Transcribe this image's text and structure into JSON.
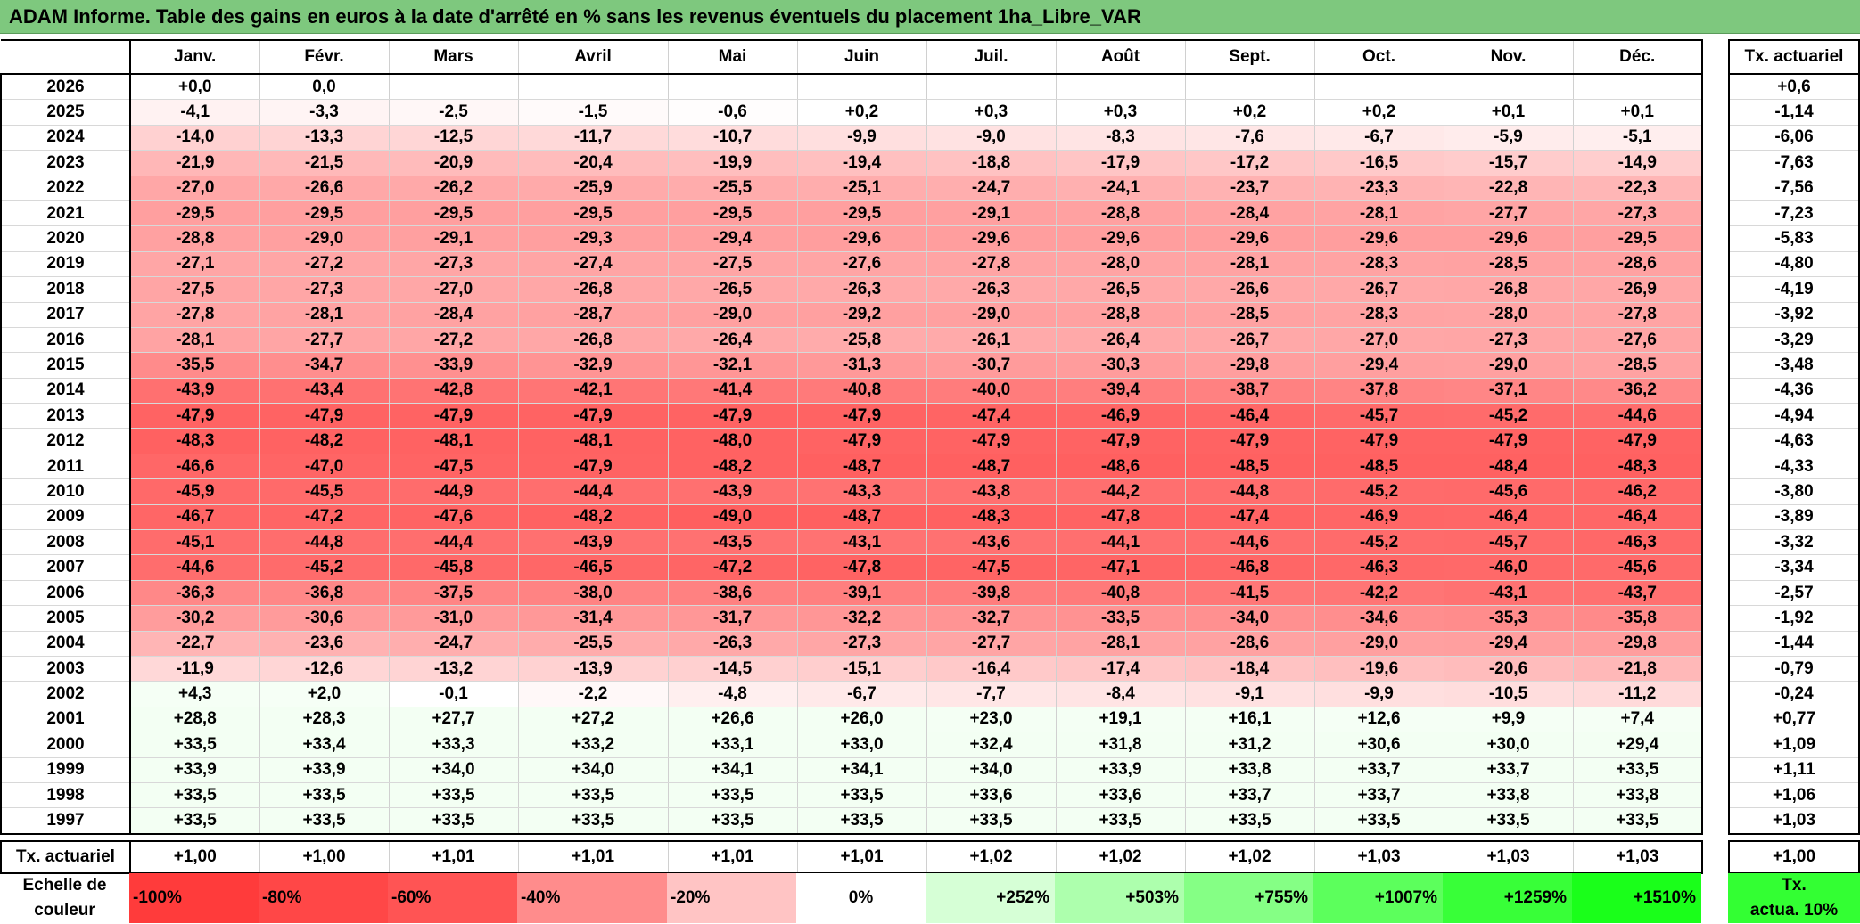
{
  "title": "ADAM Informe. Table des gains en euros à la date d'arrêté en % sans les revenus éventuels du placement 1ha_Libre_VAR",
  "months": [
    "Janv.",
    "Févr.",
    "Mars",
    "Avril",
    "Mai",
    "Juin",
    "Juil.",
    "Août",
    "Sept.",
    "Oct.",
    "Nov.",
    "Déc."
  ],
  "side_header": "Tx. actuariel",
  "rows": [
    {
      "year": "2026",
      "values": [
        "+0,0",
        "0,0",
        "",
        "",
        "",
        "",
        "",
        "",
        "",
        "",
        "",
        ""
      ],
      "act": "+0,6"
    },
    {
      "year": "2025",
      "values": [
        "-4,1",
        "-3,3",
        "-2,5",
        "-1,5",
        "-0,6",
        "+0,2",
        "+0,3",
        "+0,3",
        "+0,2",
        "+0,2",
        "+0,1",
        "+0,1"
      ],
      "act": "-1,14"
    },
    {
      "year": "2024",
      "values": [
        "-14,0",
        "-13,3",
        "-12,5",
        "-11,7",
        "-10,7",
        "-9,9",
        "-9,0",
        "-8,3",
        "-7,6",
        "-6,7",
        "-5,9",
        "-5,1"
      ],
      "act": "-6,06"
    },
    {
      "year": "2023",
      "values": [
        "-21,9",
        "-21,5",
        "-20,9",
        "-20,4",
        "-19,9",
        "-19,4",
        "-18,8",
        "-17,9",
        "-17,2",
        "-16,5",
        "-15,7",
        "-14,9"
      ],
      "act": "-7,63"
    },
    {
      "year": "2022",
      "values": [
        "-27,0",
        "-26,6",
        "-26,2",
        "-25,9",
        "-25,5",
        "-25,1",
        "-24,7",
        "-24,1",
        "-23,7",
        "-23,3",
        "-22,8",
        "-22,3"
      ],
      "act": "-7,56"
    },
    {
      "year": "2021",
      "values": [
        "-29,5",
        "-29,5",
        "-29,5",
        "-29,5",
        "-29,5",
        "-29,5",
        "-29,1",
        "-28,8",
        "-28,4",
        "-28,1",
        "-27,7",
        "-27,3"
      ],
      "act": "-7,23"
    },
    {
      "year": "2020",
      "values": [
        "-28,8",
        "-29,0",
        "-29,1",
        "-29,3",
        "-29,4",
        "-29,6",
        "-29,6",
        "-29,6",
        "-29,6",
        "-29,6",
        "-29,6",
        "-29,5"
      ],
      "act": "-5,83"
    },
    {
      "year": "2019",
      "values": [
        "-27,1",
        "-27,2",
        "-27,3",
        "-27,4",
        "-27,5",
        "-27,6",
        "-27,8",
        "-28,0",
        "-28,1",
        "-28,3",
        "-28,5",
        "-28,6"
      ],
      "act": "-4,80"
    },
    {
      "year": "2018",
      "values": [
        "-27,5",
        "-27,3",
        "-27,0",
        "-26,8",
        "-26,5",
        "-26,3",
        "-26,3",
        "-26,5",
        "-26,6",
        "-26,7",
        "-26,8",
        "-26,9"
      ],
      "act": "-4,19"
    },
    {
      "year": "2017",
      "values": [
        "-27,8",
        "-28,1",
        "-28,4",
        "-28,7",
        "-29,0",
        "-29,2",
        "-29,0",
        "-28,8",
        "-28,5",
        "-28,3",
        "-28,0",
        "-27,8"
      ],
      "act": "-3,92"
    },
    {
      "year": "2016",
      "values": [
        "-28,1",
        "-27,7",
        "-27,2",
        "-26,8",
        "-26,4",
        "-25,8",
        "-26,1",
        "-26,4",
        "-26,7",
        "-27,0",
        "-27,3",
        "-27,6"
      ],
      "act": "-3,29"
    },
    {
      "year": "2015",
      "values": [
        "-35,5",
        "-34,7",
        "-33,9",
        "-32,9",
        "-32,1",
        "-31,3",
        "-30,7",
        "-30,3",
        "-29,8",
        "-29,4",
        "-29,0",
        "-28,5"
      ],
      "act": "-3,48"
    },
    {
      "year": "2014",
      "values": [
        "-43,9",
        "-43,4",
        "-42,8",
        "-42,1",
        "-41,4",
        "-40,8",
        "-40,0",
        "-39,4",
        "-38,7",
        "-37,8",
        "-37,1",
        "-36,2"
      ],
      "act": "-4,36"
    },
    {
      "year": "2013",
      "values": [
        "-47,9",
        "-47,9",
        "-47,9",
        "-47,9",
        "-47,9",
        "-47,9",
        "-47,4",
        "-46,9",
        "-46,4",
        "-45,7",
        "-45,2",
        "-44,6"
      ],
      "act": "-4,94"
    },
    {
      "year": "2012",
      "values": [
        "-48,3",
        "-48,2",
        "-48,1",
        "-48,1",
        "-48,0",
        "-47,9",
        "-47,9",
        "-47,9",
        "-47,9",
        "-47,9",
        "-47,9",
        "-47,9"
      ],
      "act": "-4,63"
    },
    {
      "year": "2011",
      "values": [
        "-46,6",
        "-47,0",
        "-47,5",
        "-47,9",
        "-48,2",
        "-48,7",
        "-48,7",
        "-48,6",
        "-48,5",
        "-48,5",
        "-48,4",
        "-48,3"
      ],
      "act": "-4,33"
    },
    {
      "year": "2010",
      "values": [
        "-45,9",
        "-45,5",
        "-44,9",
        "-44,4",
        "-43,9",
        "-43,3",
        "-43,8",
        "-44,2",
        "-44,8",
        "-45,2",
        "-45,6",
        "-46,2"
      ],
      "act": "-3,80"
    },
    {
      "year": "2009",
      "values": [
        "-46,7",
        "-47,2",
        "-47,6",
        "-48,2",
        "-49,0",
        "-48,7",
        "-48,3",
        "-47,8",
        "-47,4",
        "-46,9",
        "-46,4",
        "-46,4"
      ],
      "act": "-3,89"
    },
    {
      "year": "2008",
      "values": [
        "-45,1",
        "-44,8",
        "-44,4",
        "-43,9",
        "-43,5",
        "-43,1",
        "-43,6",
        "-44,1",
        "-44,6",
        "-45,2",
        "-45,7",
        "-46,3"
      ],
      "act": "-3,32"
    },
    {
      "year": "2007",
      "values": [
        "-44,6",
        "-45,2",
        "-45,8",
        "-46,5",
        "-47,2",
        "-47,8",
        "-47,5",
        "-47,1",
        "-46,8",
        "-46,3",
        "-46,0",
        "-45,6"
      ],
      "act": "-3,34"
    },
    {
      "year": "2006",
      "values": [
        "-36,3",
        "-36,8",
        "-37,5",
        "-38,0",
        "-38,6",
        "-39,1",
        "-39,8",
        "-40,8",
        "-41,5",
        "-42,2",
        "-43,1",
        "-43,7"
      ],
      "act": "-2,57"
    },
    {
      "year": "2005",
      "values": [
        "-30,2",
        "-30,6",
        "-31,0",
        "-31,4",
        "-31,7",
        "-32,2",
        "-32,7",
        "-33,5",
        "-34,0",
        "-34,6",
        "-35,3",
        "-35,8"
      ],
      "act": "-1,92"
    },
    {
      "year": "2004",
      "values": [
        "-22,7",
        "-23,6",
        "-24,7",
        "-25,5",
        "-26,3",
        "-27,3",
        "-27,7",
        "-28,1",
        "-28,6",
        "-29,0",
        "-29,4",
        "-29,8"
      ],
      "act": "-1,44"
    },
    {
      "year": "2003",
      "values": [
        "-11,9",
        "-12,6",
        "-13,2",
        "-13,9",
        "-14,5",
        "-15,1",
        "-16,4",
        "-17,4",
        "-18,4",
        "-19,6",
        "-20,6",
        "-21,8"
      ],
      "act": "-0,79"
    },
    {
      "year": "2002",
      "values": [
        "+4,3",
        "+2,0",
        "-0,1",
        "-2,2",
        "-4,8",
        "-6,7",
        "-7,7",
        "-8,4",
        "-9,1",
        "-9,9",
        "-10,5",
        "-11,2"
      ],
      "act": "-0,24"
    },
    {
      "year": "2001",
      "values": [
        "+28,8",
        "+28,3",
        "+27,7",
        "+27,2",
        "+26,6",
        "+26,0",
        "+23,0",
        "+19,1",
        "+16,1",
        "+12,6",
        "+9,9",
        "+7,4"
      ],
      "act": "+0,77"
    },
    {
      "year": "2000",
      "values": [
        "+33,5",
        "+33,4",
        "+33,3",
        "+33,2",
        "+33,1",
        "+33,0",
        "+32,4",
        "+31,8",
        "+31,2",
        "+30,6",
        "+30,0",
        "+29,4"
      ],
      "act": "+1,09"
    },
    {
      "year": "1999",
      "values": [
        "+33,9",
        "+33,9",
        "+34,0",
        "+34,0",
        "+34,1",
        "+34,1",
        "+34,0",
        "+33,9",
        "+33,8",
        "+33,7",
        "+33,7",
        "+33,5"
      ],
      "act": "+1,11"
    },
    {
      "year": "1998",
      "values": [
        "+33,5",
        "+33,5",
        "+33,5",
        "+33,5",
        "+33,5",
        "+33,5",
        "+33,6",
        "+33,6",
        "+33,7",
        "+33,7",
        "+33,8",
        "+33,8"
      ],
      "act": "+1,06"
    },
    {
      "year": "1997",
      "values": [
        "+33,5",
        "+33,5",
        "+33,5",
        "+33,5",
        "+33,5",
        "+33,5",
        "+33,5",
        "+33,5",
        "+33,5",
        "+33,5",
        "+33,5",
        "+33,5"
      ],
      "act": "+1,03"
    }
  ],
  "footer": {
    "label": "Tx. actuariel",
    "values": [
      "+1,00",
      "+1,00",
      "+1,01",
      "+1,01",
      "+1,01",
      "+1,01",
      "+1,02",
      "+1,02",
      "+1,02",
      "+1,03",
      "+1,03",
      "+1,03"
    ],
    "act": "+1,00"
  },
  "scale": {
    "label_line1": "Echelle de",
    "label_line2": "couleur",
    "items": [
      {
        "text": "-100%",
        "color": "#ff3b3b"
      },
      {
        "text": "-80%",
        "color": "#ff4747"
      },
      {
        "text": "-60%",
        "color": "#ff5454"
      },
      {
        "text": "-40%",
        "color": "#ff8c8c"
      },
      {
        "text": "-20%",
        "color": "#ffc4c4"
      },
      {
        "text": "0%",
        "color": "#ffffff"
      },
      {
        "text": "+252%",
        "color": "#d6ffd6"
      },
      {
        "text": "+503%",
        "color": "#adffad"
      },
      {
        "text": "+755%",
        "color": "#85ff85"
      },
      {
        "text": "+1007%",
        "color": "#5cff5c"
      },
      {
        "text": "+1259%",
        "color": "#38ff38"
      },
      {
        "text": "+1510%",
        "color": "#1aff1a"
      }
    ],
    "act_line1": "Tx.",
    "act_line2": "actua. 10%",
    "act_color": "#33ff33"
  },
  "colors": {
    "title_bg": "#7ec87e",
    "negative_base": "#ff3b3b",
    "positive_base": "#1aff1a"
  }
}
